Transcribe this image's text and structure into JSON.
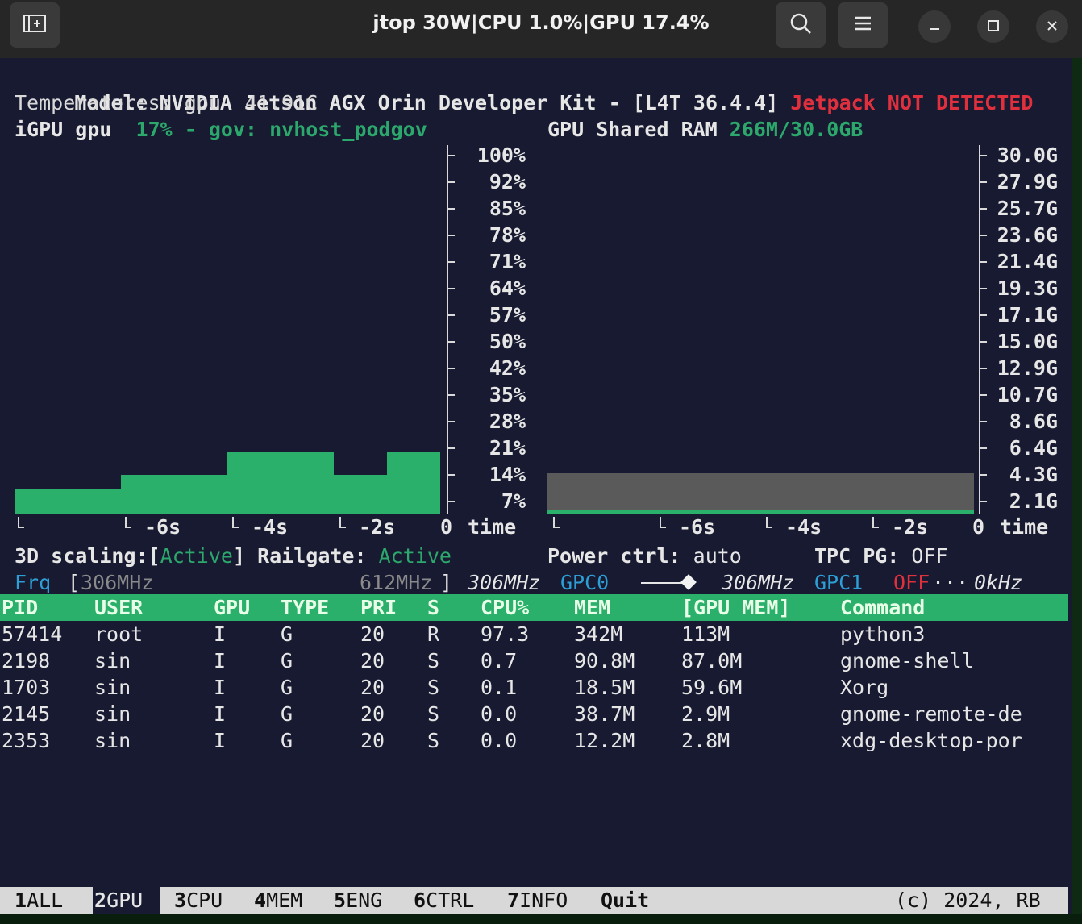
{
  "window": {
    "title": "jtop 30W|CPU 1.0%|GPU 17.4%",
    "icons": [
      "new-tab-icon",
      "search-icon",
      "menu-icon",
      "minimize-icon",
      "maximize-icon",
      "close-icon"
    ]
  },
  "info": {
    "model_line": "Model: NVIDIA Jetson AGX Orin Developer Kit - [L4T 36.4.4]",
    "jetpack_status": "Jetpack NOT DETECTED",
    "temperatures": "Temperatures: gpu  41.91C"
  },
  "gpu": {
    "label": "iGPU gpu",
    "usage": "17% - gov: nvhost_podgov",
    "y_ticks": [
      "100%",
      "92%",
      "85%",
      "78%",
      "71%",
      "64%",
      "57%",
      "50%",
      "42%",
      "35%",
      "28%",
      "21%",
      "14%",
      "7%"
    ],
    "x_ticks": [
      "-6s",
      "-4s",
      "-2s",
      "0"
    ],
    "x_label": "time",
    "usage_history_percent": [
      10,
      14,
      20,
      14,
      20
    ]
  },
  "ram": {
    "label": "GPU Shared RAM",
    "value": "266M/30.0GB",
    "y_ticks": [
      "30.0G",
      "27.9G",
      "25.7G",
      "23.6G",
      "21.4G",
      "19.3G",
      "17.1G",
      "15.0G",
      "12.9G",
      "10.7G",
      "8.6G",
      "6.4G",
      "4.3G",
      "2.1G"
    ],
    "x_ticks": [
      "-6s",
      "-4s",
      "-2s",
      "0"
    ],
    "x_label": "time",
    "shared_gb": 4.3,
    "used_gb": 0.266,
    "max_gb": 30.0
  },
  "status": {
    "scaling_label": "3D scaling:",
    "scaling_value": "Active",
    "railgate_label": "Railgate:",
    "railgate_value": "Active",
    "power_label": "Power ctrl:",
    "power_value": "auto",
    "tpc_label": "TPC PG:",
    "tpc_value": "OFF"
  },
  "freq": {
    "label": "Frq",
    "min": "306MHz",
    "max": "612MHz",
    "current": "306MHz",
    "gpc0_label": "GPC0",
    "gpc0_value": "306MHz",
    "gpc1_label": "GPC1",
    "gpc1_state": "OFF",
    "gpc1_value": "0kHz"
  },
  "table": {
    "columns": [
      "PID",
      "USER",
      "GPU",
      "TYPE",
      "PRI",
      "S",
      "CPU%",
      "MEM",
      "[GPU MEM]",
      "Command"
    ],
    "rows": [
      [
        "57414",
        "root",
        "I",
        "G",
        "20",
        "R",
        "97.3",
        "342M",
        "113M",
        "python3"
      ],
      [
        "2198",
        "sin",
        "I",
        "G",
        "20",
        "S",
        "0.7",
        "90.8M",
        "87.0M",
        "gnome-shell"
      ],
      [
        "1703",
        "sin",
        "I",
        "G",
        "20",
        "S",
        "0.1",
        "18.5M",
        "59.6M",
        "Xorg"
      ],
      [
        "2145",
        "sin",
        "I",
        "G",
        "20",
        "S",
        "0.0",
        "38.7M",
        "2.9M",
        "gnome-remote-de"
      ],
      [
        "2353",
        "sin",
        "I",
        "G",
        "20",
        "S",
        "0.0",
        "12.2M",
        "2.8M",
        "xdg-desktop-por"
      ]
    ]
  },
  "footer": {
    "tabs": [
      {
        "num": "1",
        "label": "ALL"
      },
      {
        "num": "2",
        "label": "GPU"
      },
      {
        "num": "3",
        "label": "CPU"
      },
      {
        "num": "4",
        "label": "MEM"
      },
      {
        "num": "5",
        "label": "ENG"
      },
      {
        "num": "6",
        "label": "CTRL"
      },
      {
        "num": "7",
        "label": "INFO"
      }
    ],
    "quit": "Quit",
    "copyright": "(c) 2024, RB"
  },
  "colors": {
    "accent_green": "#2ca86c",
    "header_green": "#2bb06c",
    "error_red": "#e0303e",
    "info_blue": "#2e9fd6",
    "terminal_bg": "#171a30"
  }
}
